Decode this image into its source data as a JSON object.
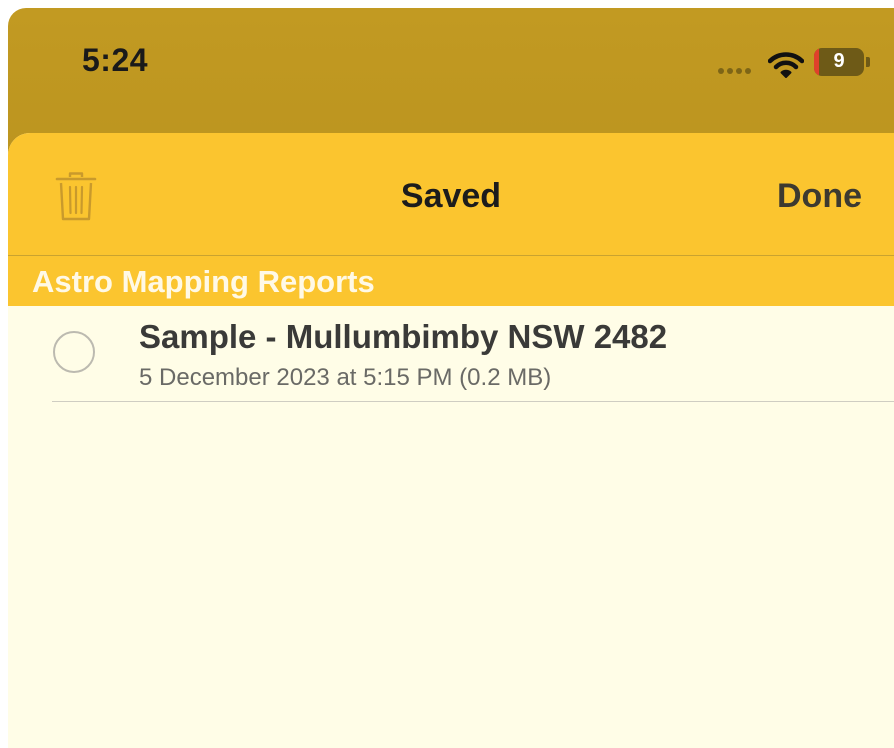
{
  "status_bar": {
    "time": "5:24",
    "battery_level": "9",
    "battery_fraction": 0.09,
    "icons": [
      "signal-dots-icon",
      "wifi-icon",
      "battery-icon"
    ]
  },
  "nav": {
    "title": "Saved",
    "done_label": "Done",
    "trash_icon": "trash-icon"
  },
  "section": {
    "title": "Astro Mapping Reports"
  },
  "items": [
    {
      "title": "Sample - Mullumbimby NSW 2482",
      "subtitle": "5 December 2023 at 5:15 PM  (0.2 MB)"
    }
  ],
  "colors": {
    "status_background": "#b08a1a",
    "nav_background": "#fbc52f",
    "list_background": "#fffde7",
    "battery_low": "#e0402b"
  }
}
